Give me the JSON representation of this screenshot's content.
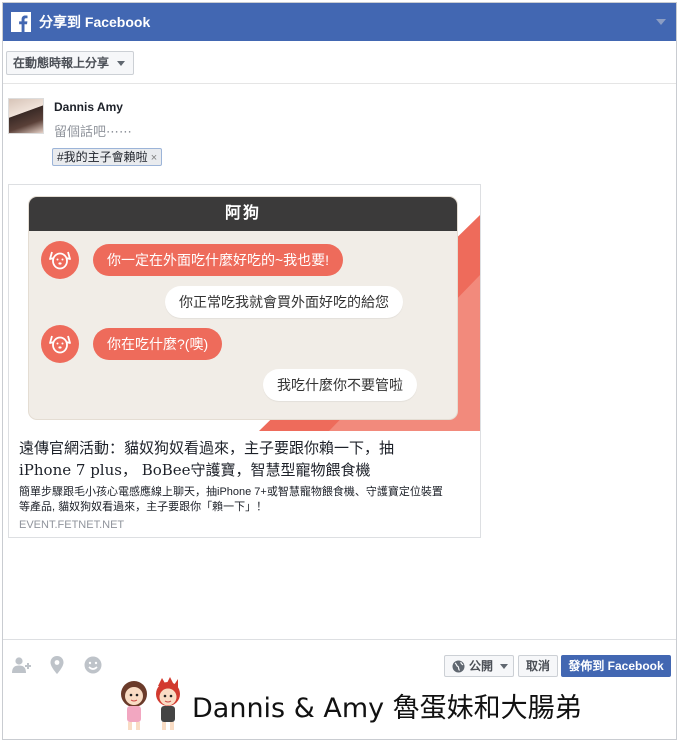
{
  "dialog": {
    "title": "分享到 Facebook",
    "share_target": "在動態時報上分享"
  },
  "composer": {
    "user_name": "Dannis Amy",
    "placeholder": "留個話吧⋯⋯",
    "hashtag": "#我的主子會賴啦",
    "hashtag_remove": "×"
  },
  "link_card": {
    "image": {
      "header": "阿狗",
      "messages": [
        {
          "side": "left",
          "text": "你一定在外面吃什麼好吃的~我也要!"
        },
        {
          "side": "right",
          "text": "你正常吃我就會買外面好吃的給您"
        },
        {
          "side": "left",
          "text": "你在吃什麼?(噢)"
        },
        {
          "side": "right",
          "text": "我吃什麼你不要管啦"
        }
      ],
      "colors": {
        "accent": "#ee6b5b",
        "panel": "#f1ede7",
        "header": "#3b3a3a"
      }
    },
    "title_line1": "遠傳官網活動：貓奴狗奴看過來，主子要跟你賴一下，抽",
    "title_line2": "iPhone 7 plus， BoBee守護寶，智慧型寵物餵食機",
    "description_line1": "簡單步驟跟毛小孩心電感應線上聊天，抽iPhone 7+或智慧寵物餵食機、守護寶定位裝置",
    "description_line2": "等產品, 貓奴狗奴看過來，主子要跟你「賴一下」！",
    "domain": "EVENT.FETNET.NET"
  },
  "toolbar": {
    "icons": [
      "tag-friends-icon",
      "location-icon",
      "feeling-icon"
    ],
    "privacy_label": "公開",
    "cancel_label": "取消",
    "post_label": "發佈到 Facebook"
  },
  "watermark": {
    "text": "Dannis & Amy 魯蛋妹和大腸弟"
  },
  "colors": {
    "brand": "#4267b2",
    "border": "#dddfe2"
  }
}
